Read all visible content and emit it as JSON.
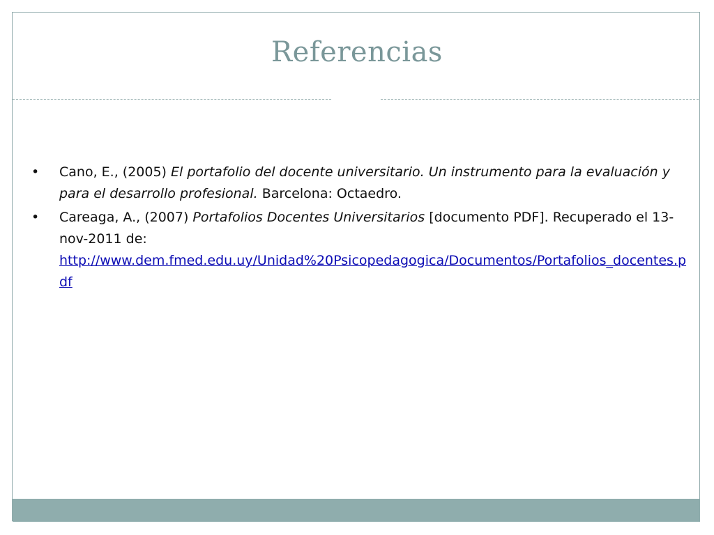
{
  "slide": {
    "title": "Referencias",
    "references": [
      {
        "bullet": "•",
        "authors": "Cano, E., (2005) ",
        "title_italic": "El portafolio del docente universitario. Un instrumento para la evaluación y para el desarrollo profesional.",
        "rest": " Barcelona: Octaedro."
      },
      {
        "bullet": "•",
        "authors": "Careaga, A., (2007) ",
        "title_italic": "Portafolios Docentes Universitarios",
        "rest": " [documento PDF]. Recuperado el 13-nov-2011 de: ",
        "link": "http://www.dem.fmed.edu.uy/Unidad%20Psicopedagogica/Documentos/Portafolios_docentes.pdf"
      }
    ]
  },
  "colors": {
    "title": "#7a9799",
    "border": "#8fa9aa",
    "footer_bar": "#8fadad",
    "link": "#0b0bb4"
  }
}
